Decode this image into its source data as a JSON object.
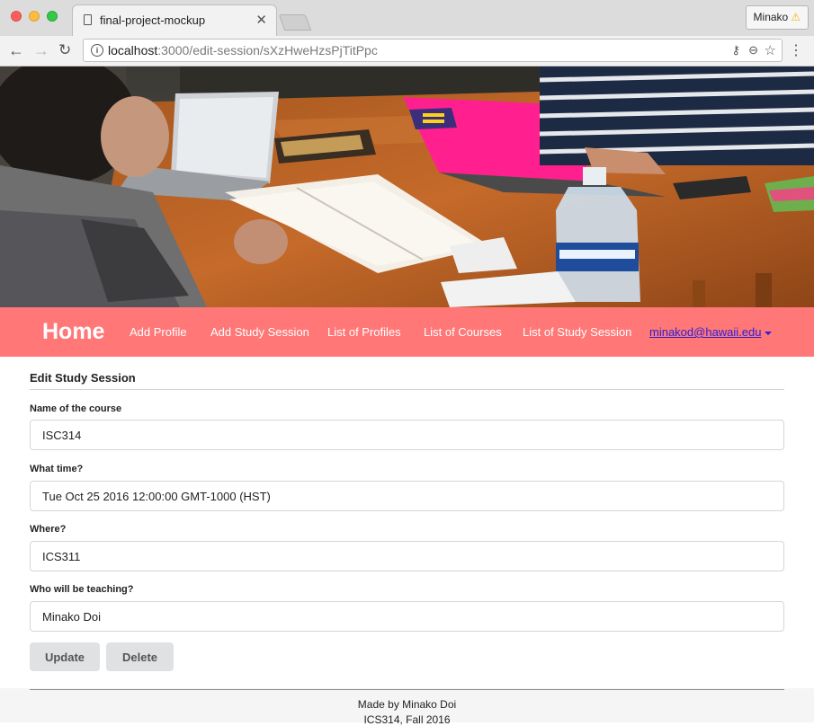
{
  "browser": {
    "tab_title": "final-project-mockup",
    "close_glyph": "✕",
    "profile_name": "Minako",
    "warning_glyph": "⚠",
    "url_host": "localhost",
    "url_rest": ":3000/edit-session/sXzHweHzsPjTitPpc"
  },
  "hero": {
    "description": "photo of students studying with laptops at a wooden table"
  },
  "navbar": {
    "brand": "Home",
    "links": [
      "Add Profile",
      "Add Study Session",
      "List of Profiles",
      "List of Courses",
      "List of Study Session"
    ],
    "user": "minakod@hawaii.edu",
    "background": "#ff7777"
  },
  "form": {
    "title": "Edit Study Session",
    "fields": [
      {
        "label": "Name of the course",
        "value": "ISC314"
      },
      {
        "label": "What time?",
        "value": "Tue Oct 25 2016 12:00:00 GMT-1000 (HST)"
      },
      {
        "label": "Where?",
        "value": "ICS311"
      },
      {
        "label": "Who will be teaching?",
        "value": "Minako Doi"
      }
    ],
    "update_label": "Update",
    "delete_label": "Delete"
  },
  "footer": {
    "line1": "Made by Minako Doi",
    "line2": "ICS314, Fall 2016"
  }
}
